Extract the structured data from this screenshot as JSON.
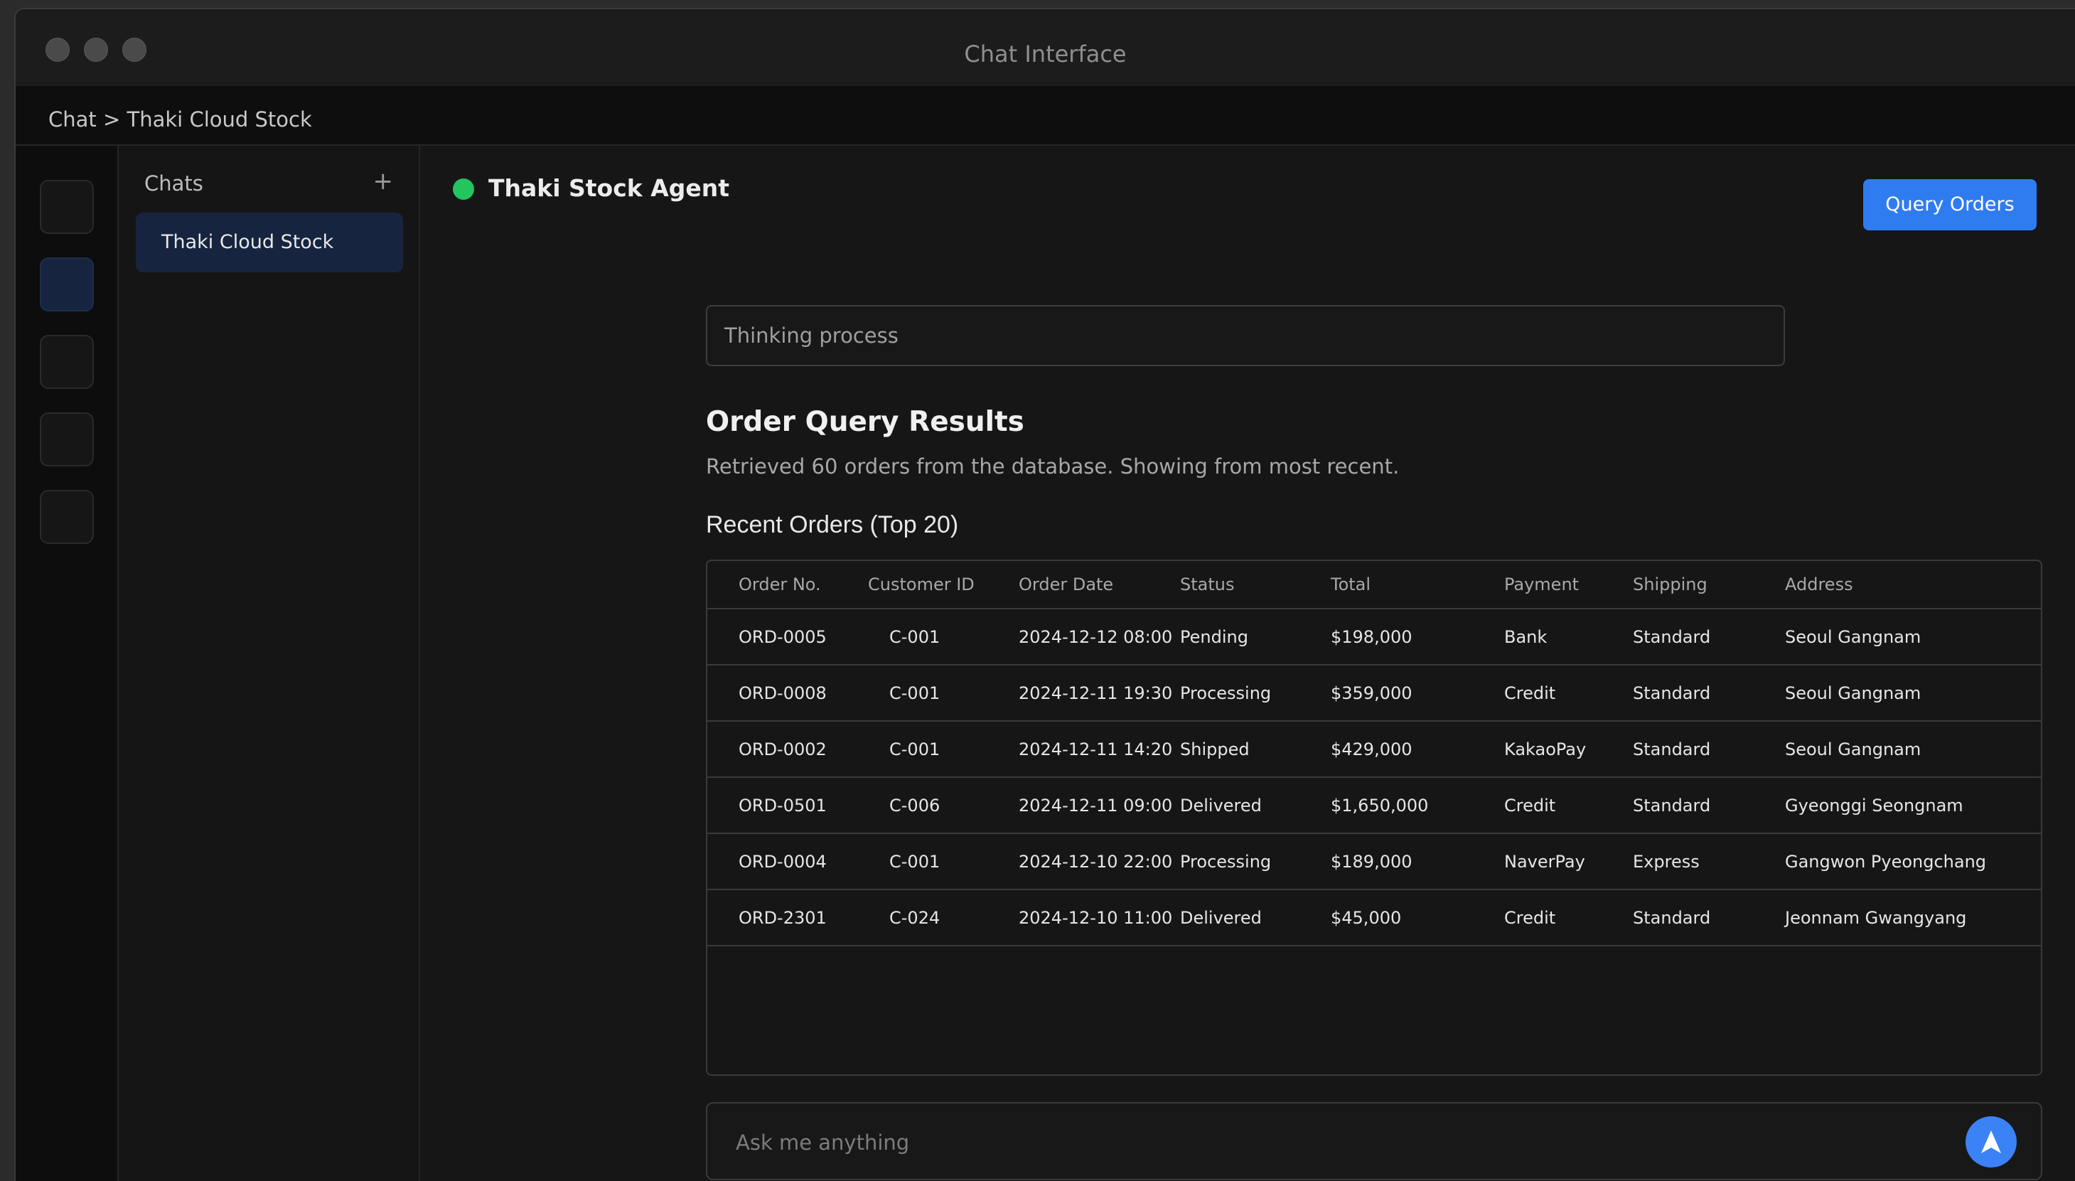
{
  "window": {
    "title": "Chat Interface"
  },
  "breadcrumb": "Chat > Thaki Cloud Stock",
  "chats": {
    "title": "Chats",
    "add_label": "+",
    "items": [
      {
        "label": "Thaki Cloud Stock",
        "active": true
      }
    ]
  },
  "agent": {
    "name": "Thaki Stock Agent",
    "status_color": "#22c55e"
  },
  "query_button": "Query Orders",
  "thinking": "Thinking process",
  "results": {
    "title": "Order Query Results",
    "subtitle": "Retrieved 60 orders from the database. Showing from most recent.",
    "table_title": "Recent Orders (Top 20)",
    "columns": [
      "Order No.",
      "Customer ID",
      "Order Date",
      "Status",
      "Total",
      "Payment",
      "Shipping",
      "Address"
    ],
    "rows": [
      [
        "ORD-0005",
        "C-001",
        "2024-12-12 08:00",
        "Pending",
        "$198,000",
        "Bank",
        "Standard",
        "Seoul Gangnam"
      ],
      [
        "ORD-0008",
        "C-001",
        "2024-12-11 19:30",
        "Processing",
        "$359,000",
        "Credit",
        "Standard",
        "Seoul Gangnam"
      ],
      [
        "ORD-0002",
        "C-001",
        "2024-12-11 14:20",
        "Shipped",
        "$429,000",
        "KakaoPay",
        "Standard",
        "Seoul Gangnam"
      ],
      [
        "ORD-0501",
        "C-006",
        "2024-12-11 09:00",
        "Delivered",
        "$1,650,000",
        "Credit",
        "Standard",
        "Gyeonggi Seongnam"
      ],
      [
        "ORD-0004",
        "C-001",
        "2024-12-10 22:00",
        "Processing",
        "$189,000",
        "NaverPay",
        "Express",
        "Gangwon Pyeongchang"
      ],
      [
        "ORD-2301",
        "C-024",
        "2024-12-10 11:00",
        "Delivered",
        "$45,000",
        "Credit",
        "Standard",
        "Jeonnam Gwangyang"
      ]
    ]
  },
  "composer": {
    "placeholder": "Ask me anything",
    "send_icon": "send-arrow-icon"
  },
  "colors": {
    "accent": "#2f7cf0",
    "active_chat": "#17243f",
    "online": "#22c55e"
  }
}
